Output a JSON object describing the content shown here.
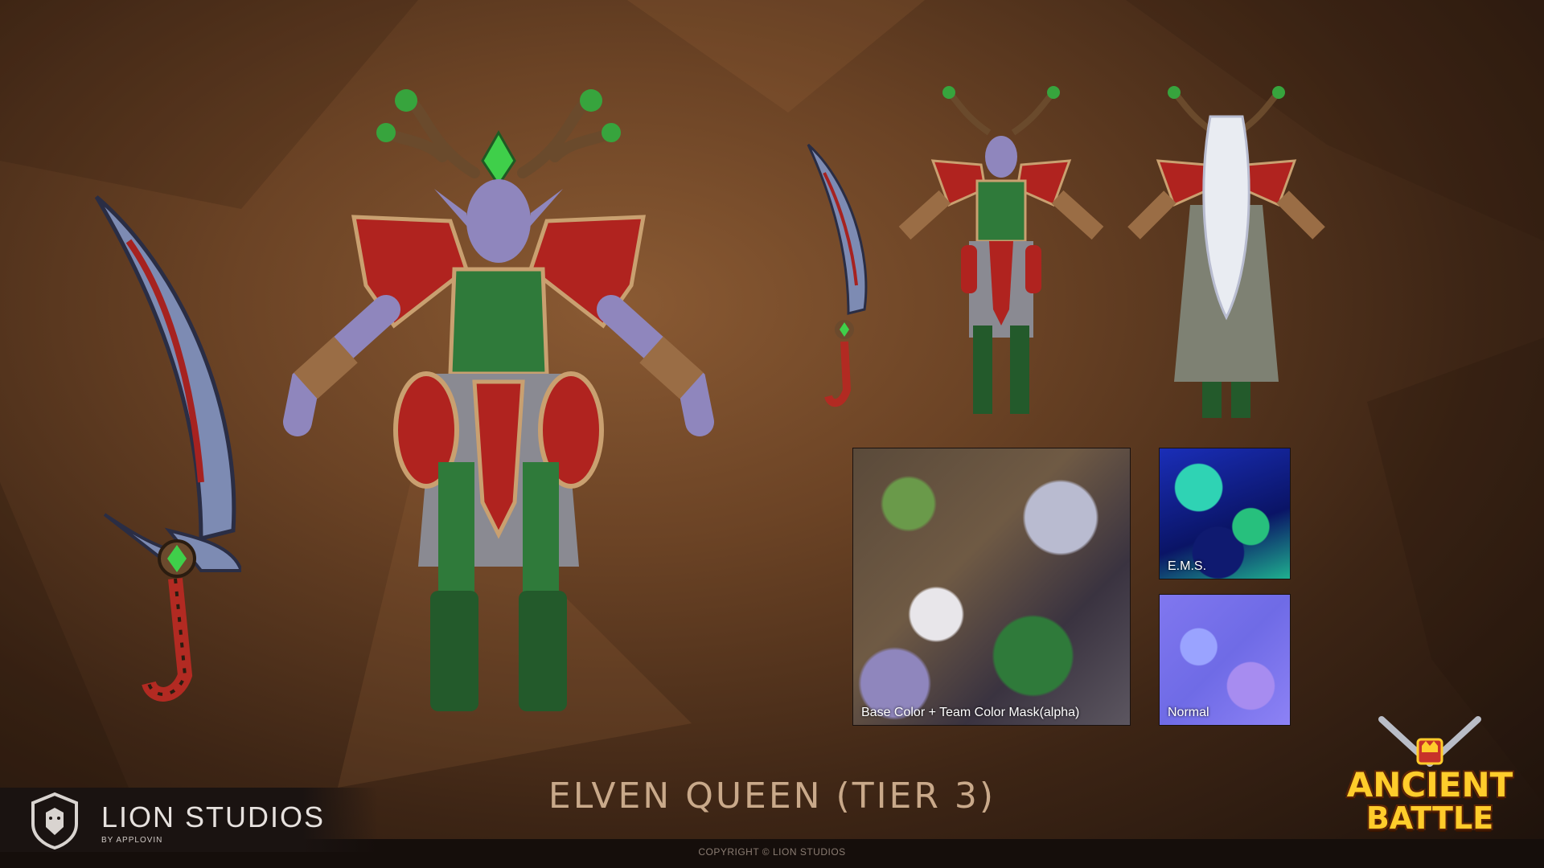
{
  "title": "ELVEN QUEEN (TIER 3)",
  "studio": {
    "name": "LION STUDIOS",
    "sub": "BY APPLOVIN"
  },
  "copyright": "COPYRIGHT © LION STUDIOS",
  "game_logo": {
    "line1": "ANCIENT",
    "line2": "BATTLE"
  },
  "textures": {
    "base": "Base Color + Team Color Mask(alpha)",
    "ems": "E.M.S.",
    "normal": "Normal"
  },
  "colors": {
    "accent_title": "#c9a98a",
    "armor_green": "#2f7a3a",
    "armor_red": "#b0231f",
    "skin": "#9b8fc6"
  }
}
